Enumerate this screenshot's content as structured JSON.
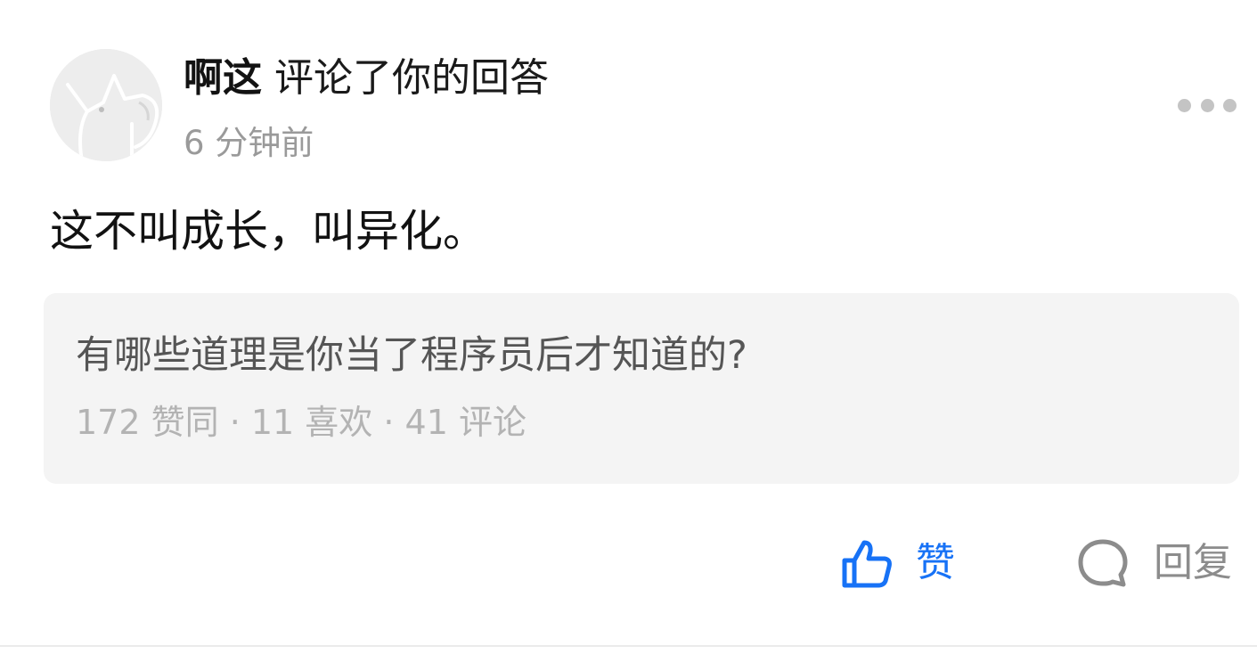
{
  "notification": {
    "username": "啊这",
    "action": "评论了你的回答",
    "time": "6 分钟前",
    "comment": "这不叫成长，叫异化。"
  },
  "quoted_answer": {
    "question": "有哪些道理是你当了程序员后才知道的?",
    "stats": "172 赞同 · 11 喜欢 · 41 评论"
  },
  "actions": {
    "like_label": "赞",
    "reply_label": "回复"
  },
  "icons": {
    "avatar": "cat-sketch-avatar",
    "more": "more-dots-icon",
    "like": "thumbs-up-icon",
    "reply": "speech-bubble-icon"
  },
  "colors": {
    "accent": "#1772f6",
    "muted": "#9a9a9a",
    "quote_bg": "#f4f4f4"
  }
}
